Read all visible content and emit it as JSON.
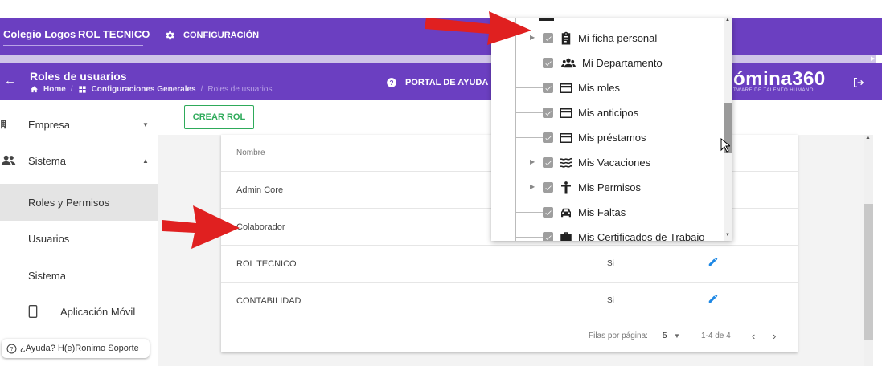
{
  "topbar": {
    "school": "Colegio Logos",
    "role": "ROL TECNICO",
    "config_label": "CONFIGURACIÓN"
  },
  "subbar": {
    "title": "Roles de usuarios",
    "crumbs": [
      "Home",
      "Configuraciones Generales",
      "Roles de usuarios"
    ],
    "help_label": "PORTAL DE AYUDA",
    "brand": "ómina360",
    "brand_sub": "TWARE DE TALENTO HUMANO"
  },
  "sidebar": {
    "items": [
      {
        "label": "Empresa",
        "icon": "building-icon"
      },
      {
        "label": "Sistema",
        "icon": "people-icon"
      },
      {
        "label": "Roles y Permisos"
      },
      {
        "label": "Usuarios"
      },
      {
        "label": "Sistema"
      },
      {
        "label": "Aplicación Móvil",
        "icon": "phone-icon"
      }
    ],
    "help_chip": "¿Ayuda? H(e)Ronimo Soporte"
  },
  "main": {
    "create_label": "CREAR ROL",
    "table": {
      "header": "Nombre",
      "rows": [
        {
          "name": "Admin Core",
          "value": ""
        },
        {
          "name": "Colaborador",
          "value": ""
        },
        {
          "name": "ROL TECNICO",
          "value": "Si"
        },
        {
          "name": "CONTABILIDAD",
          "value": "Si"
        }
      ]
    },
    "pagination": {
      "rows_per_page_label": "Filas por página:",
      "rows_per_page": "5",
      "range": "1-4 de 4"
    }
  },
  "popup": {
    "items": [
      {
        "label": "Mi ficha personal",
        "icon": "clipboard-icon",
        "expandable": true
      },
      {
        "label": "Mi Departamento",
        "icon": "group-icon",
        "expandable": false
      },
      {
        "label": "Mis roles",
        "icon": "card-icon",
        "expandable": false
      },
      {
        "label": "Mis anticipos",
        "icon": "card-icon",
        "expandable": false
      },
      {
        "label": "Mis préstamos",
        "icon": "card-icon",
        "expandable": false
      },
      {
        "label": "Mis Vacaciones",
        "icon": "waves-icon",
        "expandable": true
      },
      {
        "label": "Mis Permisos",
        "icon": "person-icon",
        "expandable": true
      },
      {
        "label": "Mis Faltas",
        "icon": "car-icon",
        "expandable": false
      },
      {
        "label": "Mis Certificados de Trabajo",
        "icon": "briefcase-icon",
        "expandable": false
      }
    ]
  },
  "colors": {
    "brand_purple": "#6b3fc1",
    "accent_green": "#2eaa5a",
    "edit_blue": "#1e88e5",
    "arrow_red": "#e02020"
  }
}
